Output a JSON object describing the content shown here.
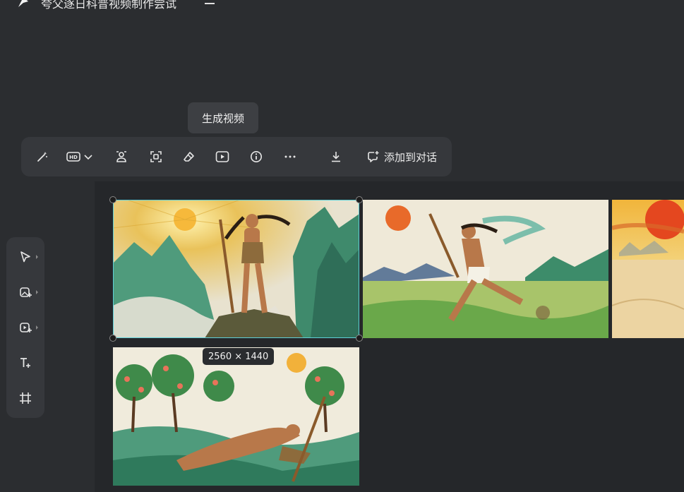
{
  "header": {
    "project_title": "夸父逐日科普视频制作尝试"
  },
  "tooltip": {
    "text": "生成视频"
  },
  "toolbar": {
    "buttons": [
      {
        "name": "magic-wand",
        "icon": "magic-wand-icon"
      },
      {
        "name": "hd-quality",
        "icon": "hd-icon"
      },
      {
        "name": "portrait",
        "icon": "person-icon"
      },
      {
        "name": "focus",
        "icon": "focus-icon"
      },
      {
        "name": "eraser",
        "icon": "eraser-icon"
      },
      {
        "name": "generate-video",
        "icon": "play-icon"
      },
      {
        "name": "info",
        "icon": "info-icon"
      },
      {
        "name": "more",
        "icon": "more-icon"
      },
      {
        "name": "download",
        "icon": "download-icon"
      }
    ],
    "add_to_chat_label": "添加到对话"
  },
  "left_tools": [
    {
      "name": "select-tool",
      "icon": "cursor-icon"
    },
    {
      "name": "add-image-tool",
      "icon": "image-add-icon"
    },
    {
      "name": "add-video-tool",
      "icon": "video-add-icon"
    },
    {
      "name": "text-tool",
      "icon": "text-icon"
    },
    {
      "name": "frame-tool",
      "icon": "frame-icon"
    }
  ],
  "canvas": {
    "selected_image_dimensions": "2560 × 1440",
    "images": [
      {
        "name": "image-kuafu-standing-mountain"
      },
      {
        "name": "image-kuafu-running"
      },
      {
        "name": "image-desert-sun"
      },
      {
        "name": "image-kuafu-resting-peach-trees"
      }
    ]
  },
  "colors": {
    "background": "#2b2d30",
    "panel": "#36383c",
    "selection": "#5ed0d8"
  }
}
